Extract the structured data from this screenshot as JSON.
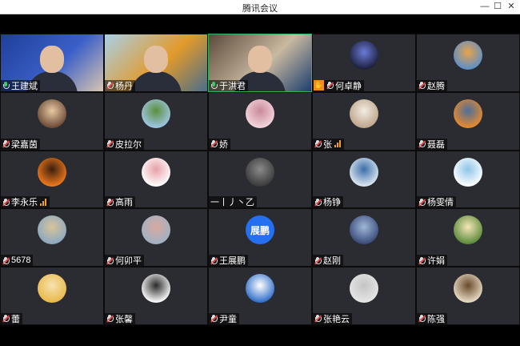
{
  "window": {
    "title": "腾讯会议",
    "minimize_glyph": "—",
    "maximize_glyph": "☐",
    "close_glyph": "✕"
  },
  "participants": [
    {
      "name": "王建斌",
      "type": "video",
      "mic": "live",
      "video_colors": [
        "#1f3f9a",
        "#3a5fc8",
        "#d8c6b0"
      ]
    },
    {
      "name": "杨丹",
      "type": "video",
      "mic": "muted",
      "video_colors": [
        "#a8d0e6",
        "#e39a2a",
        "#4a6e8a"
      ]
    },
    {
      "name": "于洪君",
      "type": "video",
      "mic": "live",
      "speaking": true,
      "video_colors": [
        "#5a4a3a",
        "#c9b9a0",
        "#1c3e6e"
      ]
    },
    {
      "name": "何卓静",
      "type": "avatar",
      "mic": "muted",
      "hand": true,
      "avatar_colors": [
        "#1b1f3a",
        "#6b7bd8"
      ],
      "hand_glyph": "✋"
    },
    {
      "name": "赵腾",
      "type": "avatar",
      "mic": "muted",
      "avatar_colors": [
        "#5c8fc8",
        "#e7a34b"
      ]
    },
    {
      "name": "梁嘉茵",
      "type": "avatar",
      "mic": "muted",
      "avatar_colors": [
        "#6a4a36",
        "#e9c9a2"
      ]
    },
    {
      "name": "皮拉尔",
      "type": "avatar",
      "mic": "muted",
      "avatar_colors": [
        "#9fc7e6",
        "#5b8f3e"
      ]
    },
    {
      "name": "娇",
      "type": "avatar",
      "mic": "muted",
      "avatar_colors": [
        "#f4d6de",
        "#c98a9a"
      ]
    },
    {
      "name": "张",
      "type": "avatar",
      "mic": "muted",
      "signal": true,
      "avatar_colors": [
        "#bda58a",
        "#f2ece4"
      ]
    },
    {
      "name": "聂磊",
      "type": "avatar",
      "mic": "muted",
      "avatar_colors": [
        "#e88a2c",
        "#4e6e9a"
      ]
    },
    {
      "name": "李永乐",
      "type": "avatar",
      "mic": "muted",
      "signal": true,
      "avatar_colors": [
        "#f07a1a",
        "#3a1e0e"
      ]
    },
    {
      "name": "高雨",
      "type": "avatar",
      "mic": "muted",
      "avatar_colors": [
        "#ffffff",
        "#e7a0a8"
      ]
    },
    {
      "name": "一丨丿丶乙",
      "type": "avatar",
      "mic": "none",
      "avatar_colors": [
        "#3a3a3a",
        "#8a8a8a"
      ]
    },
    {
      "name": "杨铮",
      "type": "avatar",
      "mic": "muted",
      "avatar_colors": [
        "#dfe9f2",
        "#3a6ea8"
      ]
    },
    {
      "name": "杨雯倩",
      "type": "avatar",
      "mic": "muted",
      "avatar_colors": [
        "#ffffff",
        "#8ec5e8"
      ]
    },
    {
      "name": "5678",
      "type": "avatar",
      "mic": "muted",
      "avatar_colors": [
        "#8aa8c0",
        "#d8c49a"
      ]
    },
    {
      "name": "何卯平",
      "type": "avatar",
      "mic": "muted",
      "avatar_colors": [
        "#9eb2c4",
        "#d9a8a0"
      ]
    },
    {
      "name": "王展鹏",
      "type": "avatar",
      "mic": "muted",
      "avatar_colors": [
        "#2470f0",
        "#2470f0"
      ],
      "avatar_text": "展鹏"
    },
    {
      "name": "赵刚",
      "type": "avatar",
      "mic": "muted",
      "avatar_colors": [
        "#3a4a7a",
        "#9fb8d8"
      ]
    },
    {
      "name": "许娟",
      "type": "avatar",
      "mic": "muted",
      "avatar_colors": [
        "#5a8a3a",
        "#f6e6b8"
      ]
    },
    {
      "name": "蕾",
      "type": "avatar",
      "mic": "muted",
      "avatar_colors": [
        "#e9b84a",
        "#f6e2b0"
      ]
    },
    {
      "name": "张馨",
      "type": "avatar",
      "mic": "muted",
      "avatar_colors": [
        "#ffffff",
        "#2a2a2a"
      ]
    },
    {
      "name": "尹童",
      "type": "avatar",
      "mic": "muted",
      "avatar_colors": [
        "#2e6ec8",
        "#ffffff"
      ]
    },
    {
      "name": "张艳云",
      "type": "avatar",
      "mic": "muted",
      "avatar_colors": [
        "#e6e6e6",
        "#c4c4c4"
      ]
    },
    {
      "name": "陈强",
      "type": "avatar",
      "mic": "muted",
      "avatar_colors": [
        "#e9ddc8",
        "#6a4a2a"
      ]
    }
  ],
  "colors": {
    "tile_bg": "#2a2c31",
    "speaking_border": "#2fb45a",
    "mic_muted_slash": "#e34848",
    "signal": "#f0a02a",
    "hand": "#f08c1e"
  }
}
